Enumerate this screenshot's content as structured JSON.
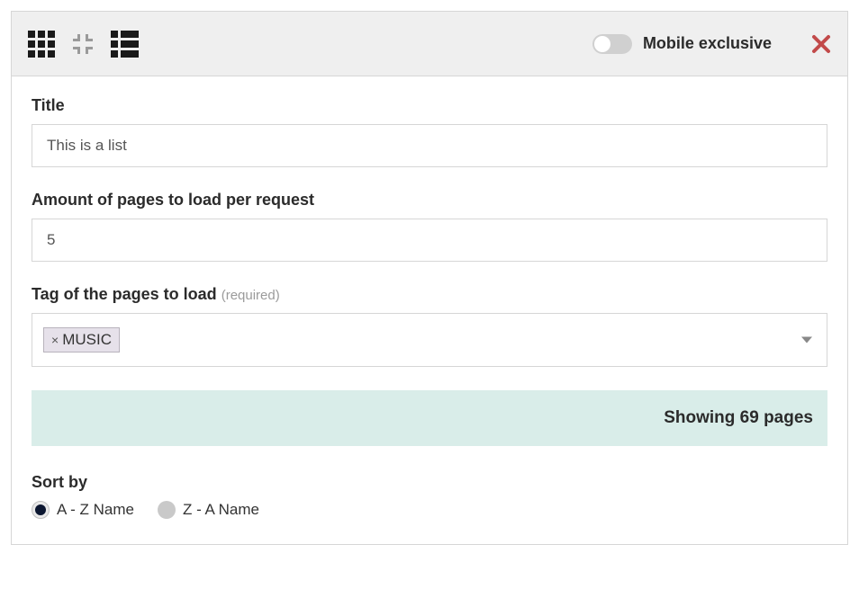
{
  "toolbar": {
    "mobile_exclusive_label": "Mobile exclusive"
  },
  "fields": {
    "title_label": "Title",
    "title_value": "This is a list",
    "amount_label": "Amount of pages to load per request",
    "amount_value": "5",
    "tag_label": "Tag of the pages to load",
    "tag_required": "(required)",
    "tag_value": "MUSIC"
  },
  "banner": {
    "text": "Showing 69 pages"
  },
  "sort": {
    "label": "Sort by",
    "options": [
      "A - Z Name",
      "Z - A Name"
    ],
    "selected_index": 0
  }
}
